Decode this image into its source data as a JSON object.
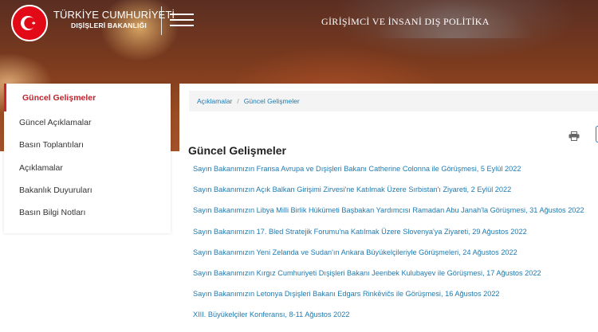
{
  "header": {
    "brand_title": "TÜRKİYE CUMHURİYETİ",
    "brand_subtitle": "DIŞİŞLERİ BAKANLIĞI",
    "tagline": "GİRİŞİMCİ VE İNSANİ DIŞ POLİTİKA",
    "logo_icon": "crescent-star-seal-icon",
    "menu_icon": "hamburger-menu-icon"
  },
  "sidebar": {
    "items": [
      {
        "label": "Güncel Gelişmeler",
        "active": true
      },
      {
        "label": "Güncel Açıklamalar",
        "active": false
      },
      {
        "label": "Basın Toplantıları",
        "active": false
      },
      {
        "label": "Açıklamalar",
        "active": false
      },
      {
        "label": "Bakanlık Duyuruları",
        "active": false
      },
      {
        "label": "Basın Bilgi Notları",
        "active": false
      }
    ]
  },
  "breadcrumb": {
    "items": [
      "Açıklamalar",
      "Güncel Gelişmeler"
    ],
    "separator": "/"
  },
  "toolbar": {
    "print_icon": "print-icon"
  },
  "main": {
    "title": "Güncel Gelişmeler",
    "news": [
      "Sayın Bakanımızın Fransa Avrupa ve Dışişleri Bakanı Catherine Colonna ile Görüşmesi, 5 Eylül 2022",
      "Sayın Bakanımızın Açık Balkan Girişimi Zirvesi'ne Katılmak Üzere Sırbistan'ı Ziyareti, 2 Eylül 2022",
      "Sayın Bakanımızın Libya Milli Birlik Hükümeti Başbakan Yardımcısı Ramadan Abu Janah'la Görüşmesi, 31 Ağustos 2022",
      "Sayın Bakanımızın 17. Bled Stratejik Forumu'na Katılmak Üzere Slovenya'ya Ziyareti, 29 Ağustos 2022",
      "Sayın Bakanımızın Yeni Zelanda ve Sudan'ın Ankara Büyükelçileriyle Görüşmeleri, 24 Ağustos 2022",
      "Sayın Bakanımızın Kırgız Cumhuriyeti Dışişleri Bakanı Jeenbek Kulubayev ile Görüşmesi, 17 Ağustos 2022",
      "Sayın Bakanımızın Letonya Dışişleri Bakanı Edgars Rinkēvičs ile Görüşmesi, 16 Ağustos 2022",
      "XIII. Büyükelçiler Konferansı, 8-11 Ağustos 2022"
    ]
  },
  "colors": {
    "accent_red": "#d3202b",
    "link_blue": "#1f7ab0",
    "seal_red": "#e30a17"
  }
}
